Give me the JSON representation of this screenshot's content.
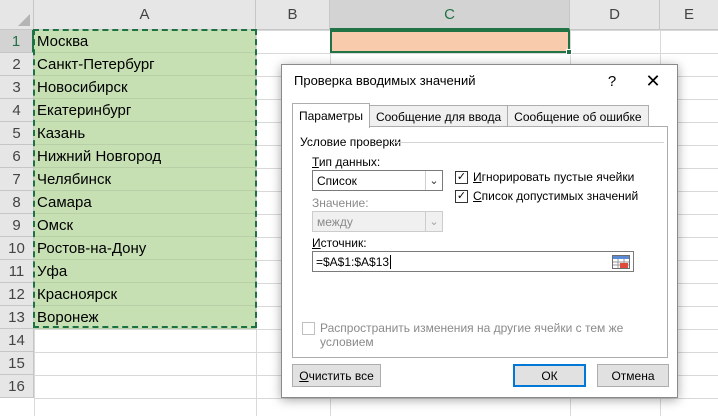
{
  "sheet": {
    "columns": [
      "A",
      "B",
      "C",
      "D",
      "E"
    ],
    "selected_column": "C",
    "rows": [
      "1",
      "2",
      "3",
      "4",
      "5",
      "6",
      "7",
      "8",
      "9",
      "10",
      "11",
      "12",
      "13",
      "14",
      "15",
      "16"
    ],
    "selected_row": "1",
    "a_cells": [
      "Москва",
      "Санкт-Петербург",
      "Новосибирск",
      "Екатеринбург",
      "Казань",
      "Нижний Новгород",
      "Челябинск",
      "Самара",
      "Омск",
      "Ростов-на-Дону",
      "Уфа",
      "Красноярск",
      "Воронеж"
    ],
    "colors": {
      "list_fill": "#c6e0b4",
      "c1_fill": "#f8cbad",
      "accent": "#217346"
    }
  },
  "dialog": {
    "title": "Проверка вводимых значений",
    "help": "?",
    "close": "✕",
    "tabs": [
      "Параметры",
      "Сообщение для ввода",
      "Сообщение об ошибке"
    ],
    "active_tab": 0,
    "group_title": "Условие проверки",
    "data_type_label_u": "Т",
    "data_type_label_rest": "ип данных:",
    "data_type_value": "Список",
    "value_label": "Значение:",
    "value_value": "между",
    "ignore_blank_u": "И",
    "ignore_blank_rest": "гнорировать пустые ячейки",
    "ignore_blank_checked": true,
    "in_cell_dropdown_u": "С",
    "in_cell_dropdown_rest": "писок допустимых значений",
    "in_cell_dropdown_checked": true,
    "source_label_u": "И",
    "source_label_rest": "сточник:",
    "source_value": "=$A$1:$A$13",
    "apply_all_line1": "Распространить изменения на другие ячейки с тем же",
    "apply_all_line2": "условием",
    "clear_all_u": "О",
    "clear_all_rest": "чистить все",
    "ok": "ОК",
    "cancel": "Отмена"
  }
}
